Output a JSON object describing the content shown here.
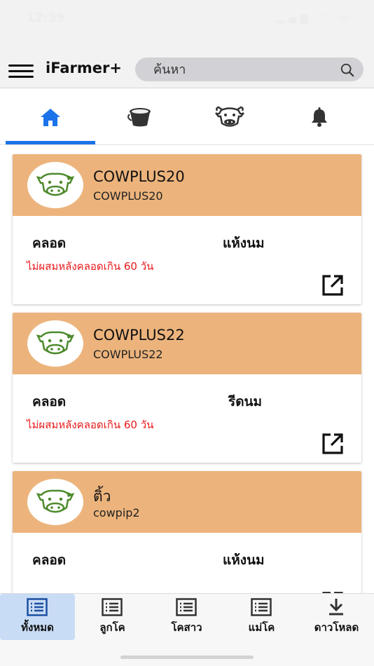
{
  "status_bar": {
    "time": "12:39"
  },
  "header": {
    "app_title": "iFarmer+",
    "search_placeholder": "ค้นหา"
  },
  "tabs": [
    {
      "name": "home",
      "icon": "home-icon",
      "active": true
    },
    {
      "name": "milk",
      "icon": "milk-bucket-icon",
      "active": false
    },
    {
      "name": "cow",
      "icon": "cow-icon",
      "active": false
    },
    {
      "name": "notifications",
      "icon": "bell-icon",
      "active": false
    }
  ],
  "colors": {
    "accent": "#1a73e8",
    "card_header": "#ecb47c",
    "alert": "#e8191c",
    "cow_green": "#4d8a2c"
  },
  "cards": [
    {
      "name": "COWPLUS20",
      "code": "COWPLUS20",
      "status": "คลอด",
      "milk_status": "แห้งนม",
      "alert": "ไม่ผสมหลังคลอดเกิน 60 วัน"
    },
    {
      "name": "COWPLUS22",
      "code": "COWPLUS22",
      "status": "คลอด",
      "milk_status": "รีดนม",
      "alert": "ไม่ผสมหลังคลอดเกิน 60 วัน"
    },
    {
      "name": "ติ้ว",
      "code": "cowpip2",
      "status": "คลอด",
      "milk_status": "แห้งนม",
      "alert": ""
    }
  ],
  "bottom_nav": [
    {
      "label": "ทั้งหมด",
      "icon": "list-icon",
      "active": true
    },
    {
      "label": "ลูกโค",
      "icon": "list-icon",
      "active": false
    },
    {
      "label": "โคสาว",
      "icon": "list-icon",
      "active": false
    },
    {
      "label": "แม่โค",
      "icon": "list-icon",
      "active": false
    },
    {
      "label": "ดาวโหลด",
      "icon": "download-icon",
      "active": false
    }
  ]
}
